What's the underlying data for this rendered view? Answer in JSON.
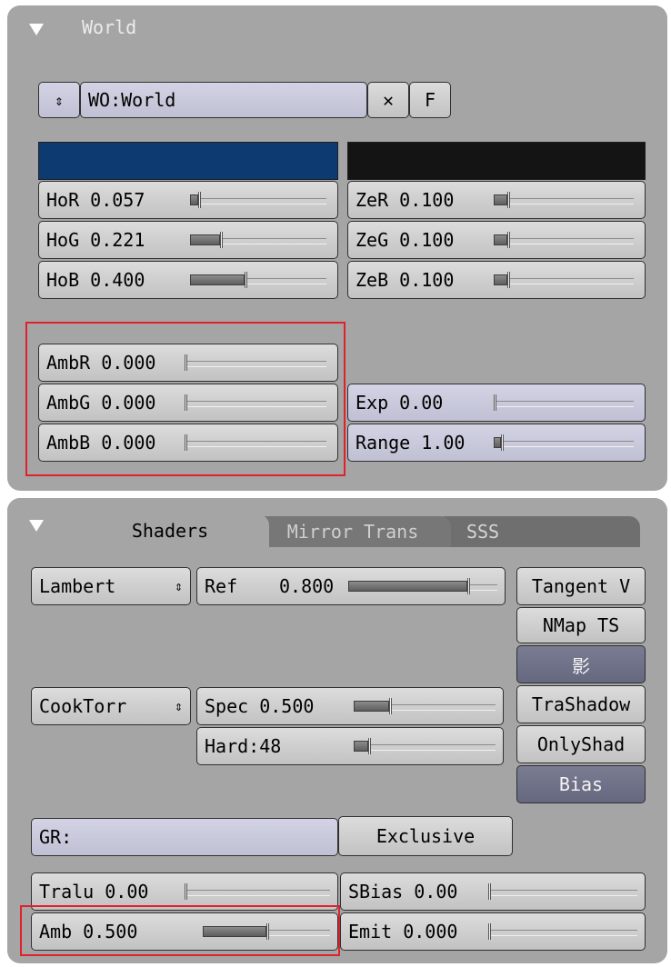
{
  "world_panel": {
    "title": "World",
    "datablock_label": "WO:World",
    "close_glyph": "✕",
    "fake_label": "F",
    "horizon_color": "#0e3a72",
    "zenith_color": "#141414",
    "horizon": [
      {
        "label": "HoR 0.057",
        "value": 0.057
      },
      {
        "label": "HoG 0.221",
        "value": 0.221
      },
      {
        "label": "HoB 0.400",
        "value": 0.4
      }
    ],
    "zenith": [
      {
        "label": "ZeR 0.100",
        "value": 0.1
      },
      {
        "label": "ZeG 0.100",
        "value": 0.1
      },
      {
        "label": "ZeB 0.100",
        "value": 0.1
      }
    ],
    "ambient": [
      {
        "label": "AmbR 0.000",
        "value": 0.0
      },
      {
        "label": "AmbG 0.000",
        "value": 0.0
      },
      {
        "label": "AmbB 0.000",
        "value": 0.0
      }
    ],
    "exp": {
      "label": "Exp 0.00",
      "value": 0.0
    },
    "range": {
      "label": "Range 1.00",
      "value": 0.05
    }
  },
  "shaders_panel": {
    "tabs": {
      "active": "Shaders",
      "mirror": "Mirror Trans",
      "sss": "SSS"
    },
    "diffuse_shader": "Lambert",
    "ref": {
      "label": "Ref",
      "value_text": "0.800",
      "value": 0.8
    },
    "spec_shader": "CookTorr",
    "spec": {
      "label": "Spec 0.500",
      "value": 0.25
    },
    "hard": {
      "label": "Hard:48",
      "value": 0.1
    },
    "toggles": {
      "tangent": "Tangent V",
      "nmap": "NMap TS",
      "shadow": "影",
      "trashadow": "TraShadow",
      "onlyshad": "OnlyShad",
      "bias": "Bias"
    },
    "group": {
      "label": "GR:",
      "exclusive": "Exclusive"
    },
    "tralu": {
      "label": "Tralu 0.00",
      "value": 0.0
    },
    "sbias": {
      "label": "SBias 0.00",
      "value": 0.0
    },
    "amb": {
      "label": "Amb 0.500",
      "value": 0.5
    },
    "emit": {
      "label": "Emit 0.000",
      "value": 0.0
    }
  }
}
